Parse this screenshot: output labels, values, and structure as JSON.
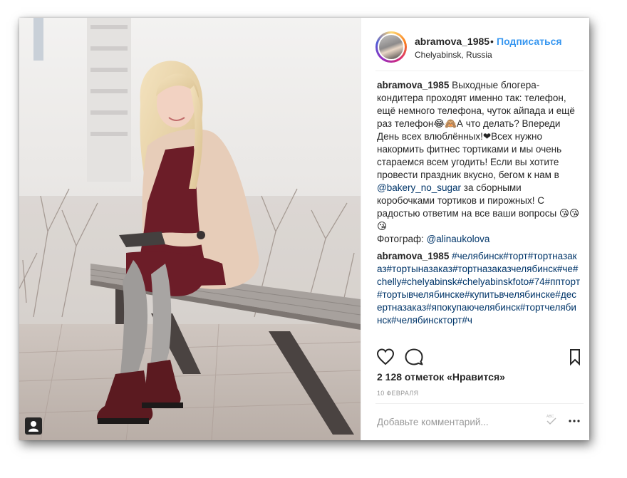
{
  "header": {
    "username": "abramova_1985",
    "separator": "•",
    "follow_label": "Подписаться",
    "location": "Chelyabinsk, Russia"
  },
  "caption": {
    "username": "abramova_1985",
    "text_1": "Выходные блогера-кондитера проходят именно так: телефон, ещё немного телефона, чуток айпада и ещё раз телефон😂🙈А что делать? Впереди День всех влюблённых!❤Всех нужно накормить фитнес тортиками и мы очень стараемся всем угодить! Если вы хотите провести праздник вкусно, бегом к нам в",
    "mention_1": "@bakery_no_sugar",
    "text_2": "за сборными коробочками тортиков и пирожных! С радостью ответим на все ваши вопросы 😘😘😘",
    "photo_credit_label": "Фотограф:",
    "mention_2": "@alinaukolova"
  },
  "hashtag_comment": {
    "username": "abramova_1985",
    "text": "#челябинск#торт#тортназаказ#тортыназаказ#тортназаказчелябинск#че#chelly#chelyabinsk#chelyabinskfoto#74#пптopт#тортывчелябинске#купитьвчелябинске#десертназаказ#япокупаючелябинск#тортчелябинск#челябинскторт#ч"
  },
  "actions": {
    "like_icon": "heart-icon",
    "comment_icon": "comment-bubble-icon",
    "save_icon": "bookmark-icon"
  },
  "likes_text": "2 128 отметок «Нравится»",
  "date_text": "10 февраля",
  "comment_box": {
    "placeholder": "Добавьте комментарий...",
    "more_label": "..."
  },
  "colors": {
    "accent": "#3897f0",
    "link": "#003569",
    "text": "#262626",
    "muted": "#999999"
  }
}
